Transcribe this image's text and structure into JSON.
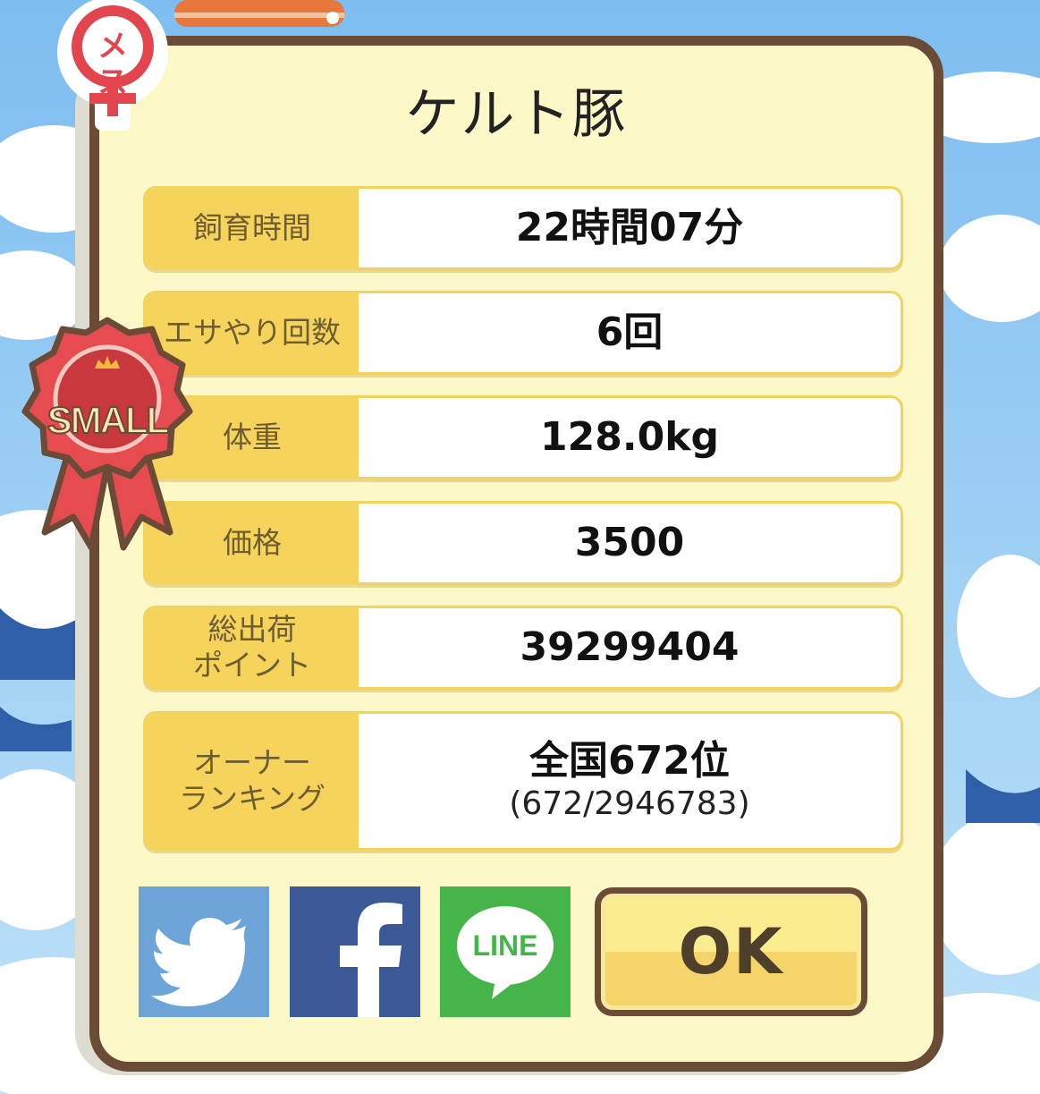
{
  "header": {
    "gender_badge": "メス"
  },
  "title": "ケルト豚",
  "size_ribbon": "SMALL",
  "stats": [
    {
      "label": "飼育時間",
      "value": "22時間07分"
    },
    {
      "label": "エサやり回数",
      "value": "6回"
    },
    {
      "label": "体重",
      "value": "128.0kg"
    },
    {
      "label": "価格",
      "value": "3500"
    },
    {
      "label": "総出荷\nポイント",
      "value": "39299404"
    },
    {
      "label": "オーナー\nランキング",
      "value": "全国672位",
      "sub_value": "(672/2946783)"
    }
  ],
  "share": {
    "line_label": "LINE"
  },
  "ok_label": "OK",
  "colors": {
    "panel": "#fdf8c8",
    "border": "#6b4a36",
    "label_bg": "#f6d35a",
    "sky": "#9fd0f4",
    "ribbon": "#e04a4a"
  },
  "icons": [
    "female-icon",
    "ribbon-icon",
    "twitter-icon",
    "facebook-icon",
    "line-icon"
  ]
}
